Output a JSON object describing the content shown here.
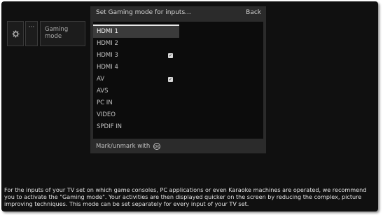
{
  "menu": {
    "settings_icon": "gear-icon",
    "more_label": "···",
    "gaming_label": "Gaming mode"
  },
  "dialog": {
    "title": "Set Gaming mode for inputs...",
    "back_label": "Back",
    "items": [
      {
        "label": "HDMI 1",
        "checked": false,
        "selected": true
      },
      {
        "label": "HDMI 2",
        "checked": false,
        "selected": false
      },
      {
        "label": "HDMI 3",
        "checked": true,
        "selected": false
      },
      {
        "label": "HDMI 4",
        "checked": false,
        "selected": false
      },
      {
        "label": "AV",
        "checked": true,
        "selected": false
      },
      {
        "label": "AVS",
        "checked": false,
        "selected": false
      },
      {
        "label": "PC IN",
        "checked": false,
        "selected": false
      },
      {
        "label": "VIDEO",
        "checked": false,
        "selected": false
      },
      {
        "label": "SPDIF IN",
        "checked": false,
        "selected": false
      }
    ],
    "hint_text": "Mark/unmark with",
    "ok_label": "OK"
  },
  "help_text": "For the inputs of your TV set on which game consoles, PC applications or even Karaoke machines are operated, we recommend you to activate the \"Gaming mode\". Your activities are then displayed quicker on the screen by reducing the complex, picture improving techniques. This mode can be set separately for every input of your TV set."
}
